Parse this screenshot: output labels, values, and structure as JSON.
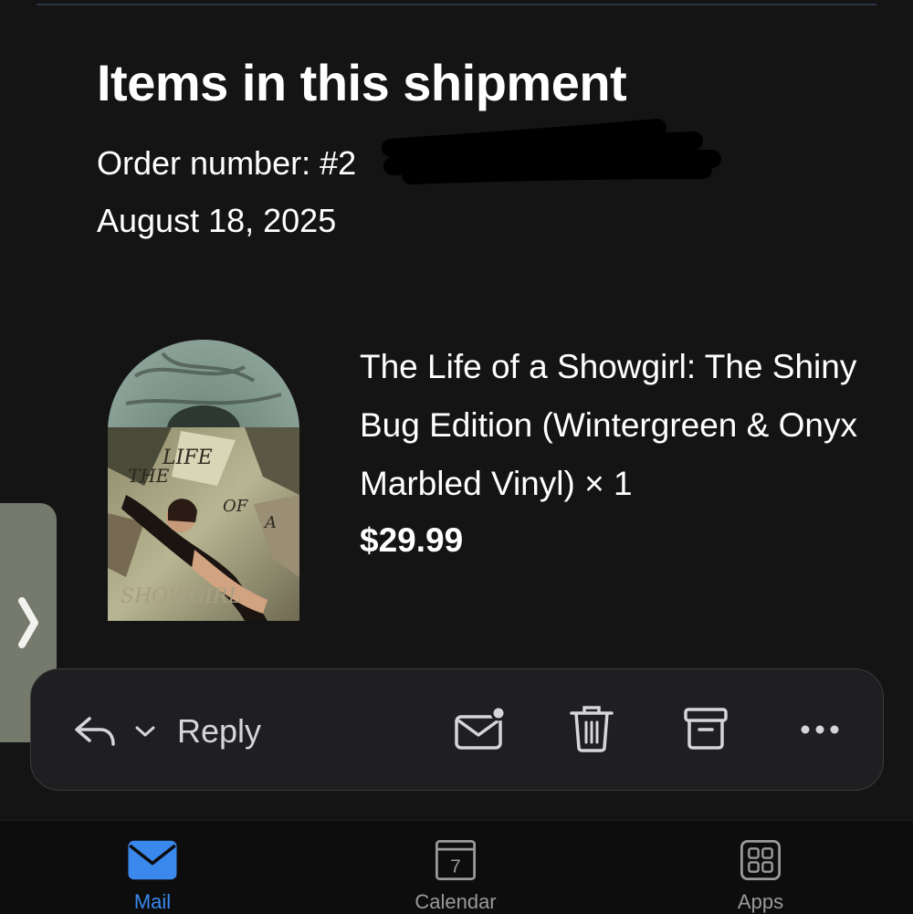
{
  "shipment": {
    "heading": "Items in this shipment",
    "order_number_label": "Order number: #2",
    "date": "August 18, 2025"
  },
  "product": {
    "title": "The Life of a Showgirl: The Shiny Bug Edition (Wintergreen & Onyx Marbled Vinyl) × 1",
    "price": "$29.99",
    "cover_text": {
      "the": "THE",
      "life": "LIFE",
      "of": "OF",
      "a": "A",
      "showgirl": "SHOWGIRL"
    }
  },
  "action_bar": {
    "reply_label": "Reply",
    "icons": [
      "reply-arrow-icon",
      "chevron-down-icon",
      "mark-unread-icon",
      "trash-icon",
      "archive-icon",
      "more-icon"
    ]
  },
  "tabs": [
    {
      "label": "Mail",
      "icon": "mail-icon",
      "active": true
    },
    {
      "label": "Calendar",
      "icon": "calendar-icon",
      "icon_text": "7"
    },
    {
      "label": "Apps",
      "icon": "apps-icon"
    }
  ],
  "colors": {
    "background": "#141414",
    "accent": "#3a88ec",
    "action_bar_bg": "#1f1f21",
    "handle": "#757a6c"
  }
}
